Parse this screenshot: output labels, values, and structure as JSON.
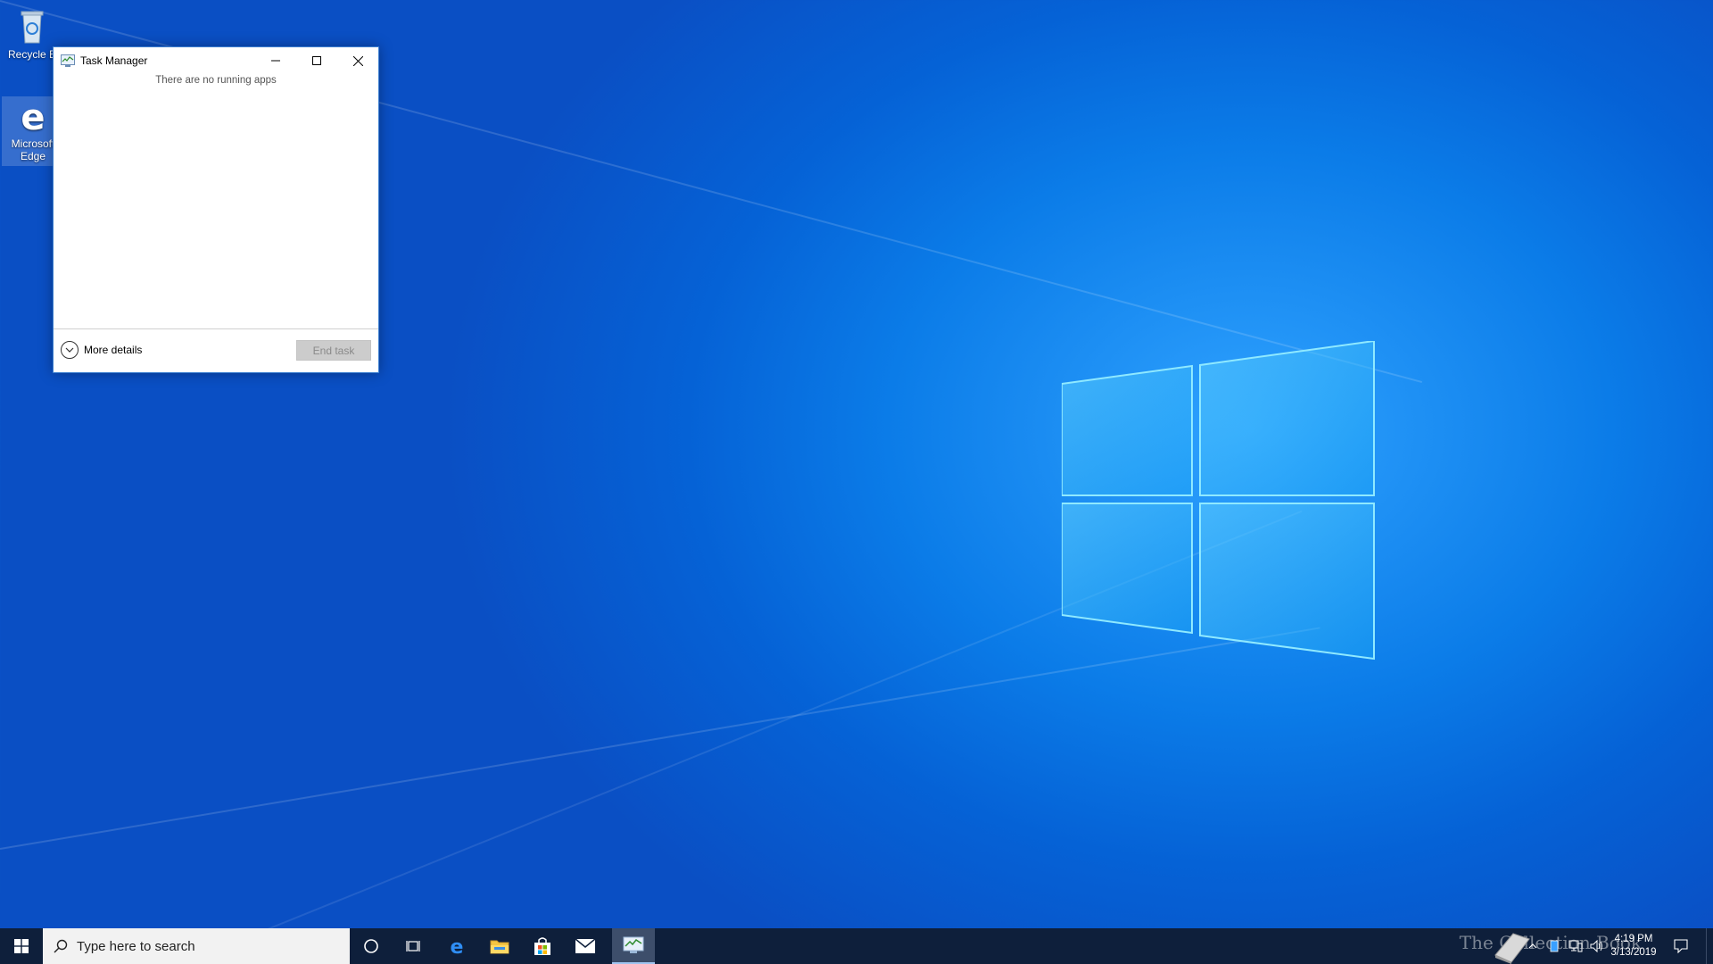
{
  "desktop": {
    "icons": [
      {
        "label": "Recycle B",
        "icon": "recycle-bin-icon"
      },
      {
        "label": "Microsoft Edge",
        "icon": "edge-icon"
      }
    ]
  },
  "task_manager": {
    "title": "Task Manager",
    "empty_message": "There are no running apps",
    "more_details_label": "More details",
    "end_task_label": "End task"
  },
  "taskbar": {
    "search_placeholder": "Type here to search",
    "pinned": [
      "start-icon",
      "cortana-icon",
      "task-view-icon",
      "edge-icon",
      "file-explorer-icon",
      "store-icon",
      "mail-icon",
      "task-manager-icon"
    ],
    "clock_time": "4:19 PM",
    "clock_date": "3/13/2019",
    "watermark": "The Collection Book"
  },
  "colors": {
    "taskbar_bg": "#0e1f3b",
    "desktop_blue": "#0b7ce8",
    "window_border": "#3c7fd0"
  }
}
